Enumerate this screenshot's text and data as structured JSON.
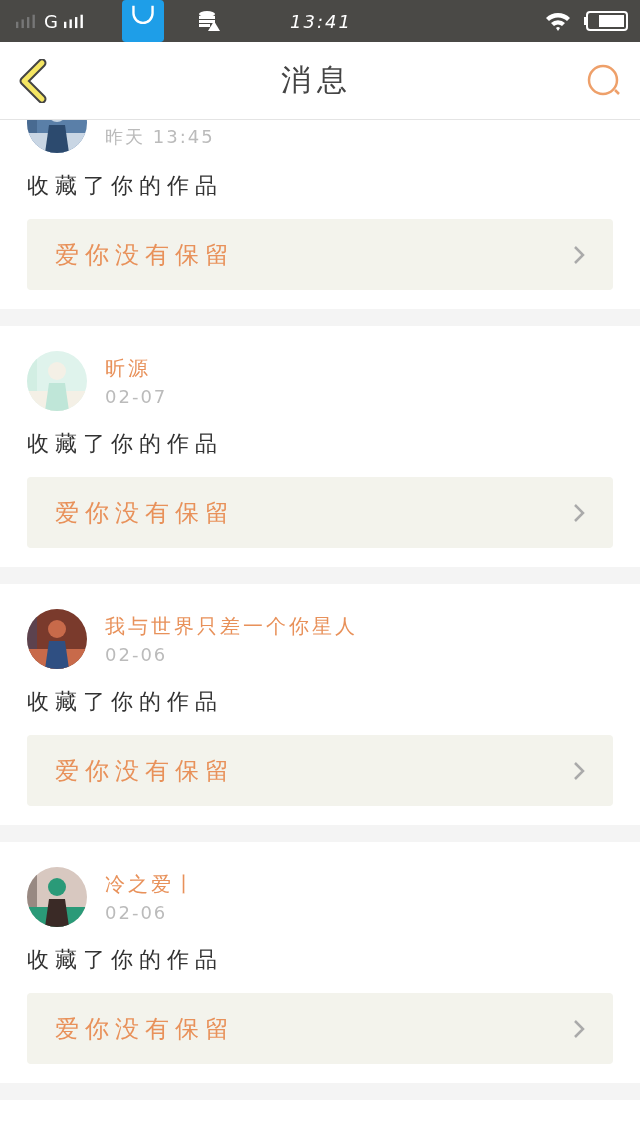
{
  "status_bar": {
    "network": "G",
    "time": "13:41"
  },
  "header": {
    "title": "消息"
  },
  "messages": [
    {
      "time": "昨天 13:45",
      "action": "收藏了你的作品",
      "work": "爱你没有保留"
    },
    {
      "name": "昕源",
      "time": "02-07",
      "action": "收藏了你的作品",
      "work": "爱你没有保留"
    },
    {
      "name": "我与世界只差一个你星人",
      "time": "02-06",
      "action": "收藏了你的作品",
      "work": "爱你没有保留"
    },
    {
      "name": "冷之爱丨",
      "time": "02-06",
      "action": "收藏了你的作品",
      "work": "爱你没有保留"
    }
  ]
}
